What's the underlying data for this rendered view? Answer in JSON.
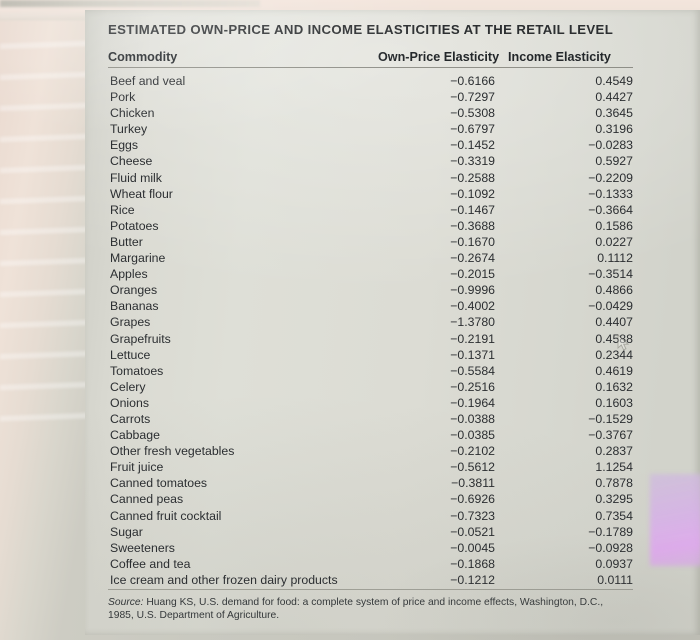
{
  "table": {
    "title": "Estimated Own-Price and Income Elasticities At the Retail Level",
    "headers": {
      "commodity": "Commodity",
      "own_price": "Own-Price Elasticity",
      "income": "Income Elasticity"
    },
    "rows": [
      {
        "commodity": "Beef and veal",
        "own_price": "−0.6166",
        "income": "0.4549"
      },
      {
        "commodity": "Pork",
        "own_price": "−0.7297",
        "income": "0.4427"
      },
      {
        "commodity": "Chicken",
        "own_price": "−0.5308",
        "income": "0.3645"
      },
      {
        "commodity": "Turkey",
        "own_price": "−0.6797",
        "income": "0.3196"
      },
      {
        "commodity": "Eggs",
        "own_price": "−0.1452",
        "income": "−0.0283"
      },
      {
        "commodity": "Cheese",
        "own_price": "−0.3319",
        "income": "0.5927"
      },
      {
        "commodity": "Fluid milk",
        "own_price": "−0.2588",
        "income": "−0.2209"
      },
      {
        "commodity": "Wheat flour",
        "own_price": "−0.1092",
        "income": "−0.1333"
      },
      {
        "commodity": "Rice",
        "own_price": "−0.1467",
        "income": "−0.3664"
      },
      {
        "commodity": "Potatoes",
        "own_price": "−0.3688",
        "income": "0.1586"
      },
      {
        "commodity": "Butter",
        "own_price": "−0.1670",
        "income": "0.0227"
      },
      {
        "commodity": "Margarine",
        "own_price": "−0.2674",
        "income": "0.1112"
      },
      {
        "commodity": "Apples",
        "own_price": "−0.2015",
        "income": "−0.3514"
      },
      {
        "commodity": "Oranges",
        "own_price": "−0.9996",
        "income": "0.4866"
      },
      {
        "commodity": "Bananas",
        "own_price": "−0.4002",
        "income": "−0.0429"
      },
      {
        "commodity": "Grapes",
        "own_price": "−1.3780",
        "income": "0.4407"
      },
      {
        "commodity": "Grapefruits",
        "own_price": "−0.2191",
        "income": "0.4588"
      },
      {
        "commodity": "Lettuce",
        "own_price": "−0.1371",
        "income": "0.2344"
      },
      {
        "commodity": "Tomatoes",
        "own_price": "−0.5584",
        "income": "0.4619"
      },
      {
        "commodity": "Celery",
        "own_price": "−0.2516",
        "income": "0.1632"
      },
      {
        "commodity": "Onions",
        "own_price": "−0.1964",
        "income": "0.1603"
      },
      {
        "commodity": "Carrots",
        "own_price": "−0.0388",
        "income": "−0.1529"
      },
      {
        "commodity": "Cabbage",
        "own_price": "−0.0385",
        "income": "−0.3767"
      },
      {
        "commodity": "Other fresh vegetables",
        "own_price": "−0.2102",
        "income": "0.2837"
      },
      {
        "commodity": "Fruit juice",
        "own_price": "−0.5612",
        "income": "1.1254"
      },
      {
        "commodity": "Canned tomatoes",
        "own_price": "−0.3811",
        "income": "0.7878"
      },
      {
        "commodity": "Canned peas",
        "own_price": "−0.6926",
        "income": "0.3295"
      },
      {
        "commodity": "Canned fruit cocktail",
        "own_price": "−0.7323",
        "income": "0.7354"
      },
      {
        "commodity": "Sugar",
        "own_price": "−0.0521",
        "income": "−0.1789"
      },
      {
        "commodity": "Sweeteners",
        "own_price": "−0.0045",
        "income": "−0.0928"
      },
      {
        "commodity": "Coffee and tea",
        "own_price": "−0.1868",
        "income": "0.0937"
      },
      {
        "commodity": "Ice cream and other frozen dairy products",
        "own_price": "−0.1212",
        "income": "0.0111"
      }
    ],
    "source": {
      "label": "Source:",
      "text": " Huang KS, U.S. demand for food: a complete system of price and income effects, Washington, D.C., 1985, U.S. Department of Agriculture."
    }
  },
  "chart_data": {
    "type": "table",
    "title": "Estimated Own-Price and Income Elasticities At the Retail Level",
    "columns": [
      "Commodity",
      "Own-Price Elasticity",
      "Income Elasticity"
    ],
    "categories": [
      "Beef and veal",
      "Pork",
      "Chicken",
      "Turkey",
      "Eggs",
      "Cheese",
      "Fluid milk",
      "Wheat flour",
      "Rice",
      "Potatoes",
      "Butter",
      "Margarine",
      "Apples",
      "Oranges",
      "Bananas",
      "Grapes",
      "Grapefruits",
      "Lettuce",
      "Tomatoes",
      "Celery",
      "Onions",
      "Carrots",
      "Cabbage",
      "Other fresh vegetables",
      "Fruit juice",
      "Canned tomatoes",
      "Canned peas",
      "Canned fruit cocktail",
      "Sugar",
      "Sweeteners",
      "Coffee and tea",
      "Ice cream and other frozen dairy products"
    ],
    "series": [
      {
        "name": "Own-Price Elasticity",
        "values": [
          -0.6166,
          -0.7297,
          -0.5308,
          -0.6797,
          -0.1452,
          -0.3319,
          -0.2588,
          -0.1092,
          -0.1467,
          -0.3688,
          -0.167,
          -0.2674,
          -0.2015,
          -0.9996,
          -0.4002,
          -1.378,
          -0.2191,
          -0.1371,
          -0.5584,
          -0.2516,
          -0.1964,
          -0.0388,
          -0.0385,
          -0.2102,
          -0.5612,
          -0.3811,
          -0.6926,
          -0.7323,
          -0.0521,
          -0.0045,
          -0.1868,
          -0.1212
        ]
      },
      {
        "name": "Income Elasticity",
        "values": [
          0.4549,
          0.4427,
          0.3645,
          0.3196,
          -0.0283,
          0.5927,
          -0.2209,
          -0.1333,
          -0.3664,
          0.1586,
          0.0227,
          0.1112,
          -0.3514,
          0.4866,
          -0.0429,
          0.4407,
          0.4588,
          0.2344,
          0.4619,
          0.1632,
          0.1603,
          -0.1529,
          -0.3767,
          0.2837,
          1.1254,
          0.7878,
          0.3295,
          0.7354,
          -0.1789,
          -0.0928,
          0.0937,
          0.0111
        ]
      }
    ],
    "source": "Source: Huang KS, U.S. demand for food: a complete system of price and income effects, Washington, D.C., 1985, U.S. Department of Agriculture."
  }
}
